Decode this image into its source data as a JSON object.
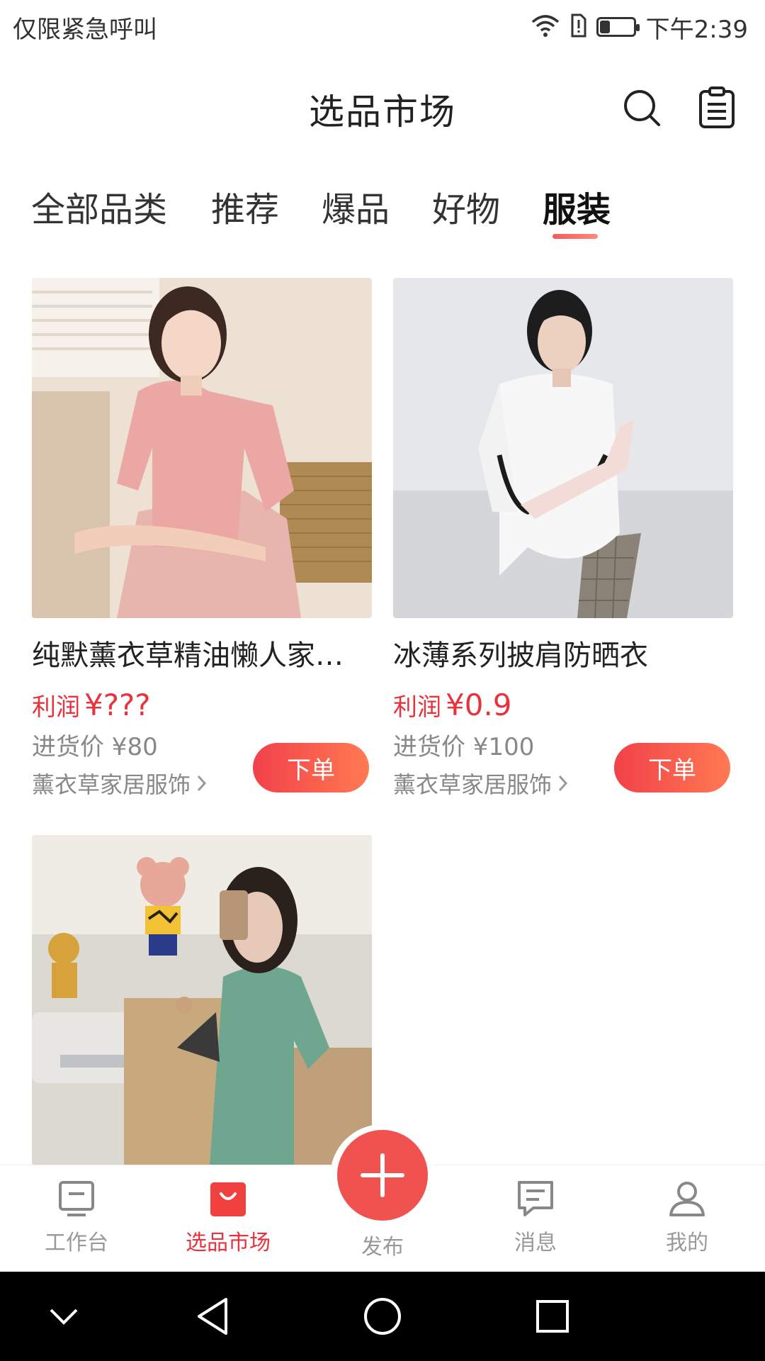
{
  "status_bar": {
    "carrier_text": "仅限紧急呼叫",
    "time": "下午2:39",
    "battery_level": 0.3
  },
  "header": {
    "title": "选品市场",
    "search_icon": "search-icon",
    "clipboard_icon": "clipboard-icon"
  },
  "tabs": [
    {
      "label": "全部品类",
      "active": false
    },
    {
      "label": "推荐",
      "active": false
    },
    {
      "label": "爆品",
      "active": false
    },
    {
      "label": "好物",
      "active": false
    },
    {
      "label": "服装",
      "active": true
    }
  ],
  "products": [
    {
      "title": "纯默薰衣草精油懒人家…",
      "profit_label": "利润",
      "profit_value": "¥???",
      "cost": "进货价 ¥80",
      "shop": "薰衣草家居服饰",
      "order_label": "下单"
    },
    {
      "title": "冰薄系列披肩防晒衣",
      "profit_label": "利润",
      "profit_value": "¥0.9",
      "cost": "进货价 ¥100",
      "shop": "薰衣草家居服饰",
      "order_label": "下单"
    },
    {
      "title": "",
      "profit_label": "",
      "profit_value": "",
      "cost": "",
      "shop": "",
      "order_label": ""
    }
  ],
  "bottom_nav": {
    "items": [
      {
        "label": "工作台",
        "icon": "monitor-icon",
        "active": false
      },
      {
        "label": "选品市场",
        "icon": "shopping-bag-icon",
        "active": true
      },
      {
        "label": "发布",
        "icon": "plus-icon",
        "active": false
      },
      {
        "label": "消息",
        "icon": "message-icon",
        "active": false
      },
      {
        "label": "我的",
        "icon": "user-icon",
        "active": false
      }
    ]
  },
  "colors": {
    "accent": "#e8323c",
    "fab": "#f0534f"
  }
}
